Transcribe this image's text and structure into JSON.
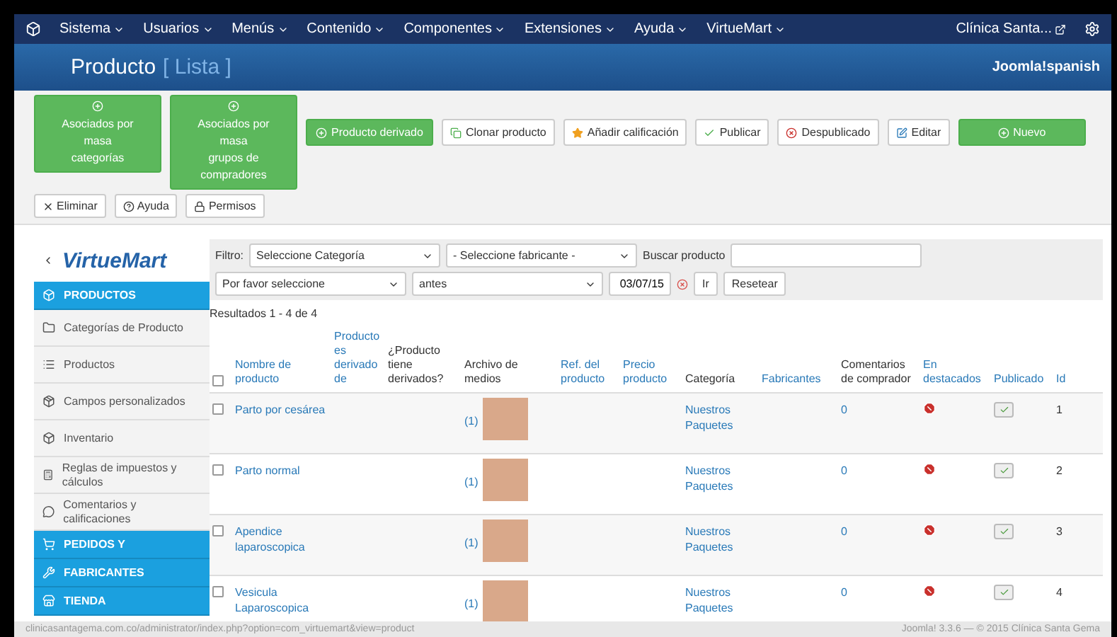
{
  "top_menu": {
    "items": [
      "Sistema",
      "Usuarios",
      "Menús",
      "Contenido",
      "Componentes",
      "Extensiones",
      "Ayuda",
      "VirtueMart"
    ],
    "site": "Clínica Santa..."
  },
  "header": {
    "title": "Producto",
    "subtitle": "[ Lista ]",
    "brand": "Joomla!spanish"
  },
  "toolbar": {
    "buttons": [
      {
        "kind": "green",
        "label": "Asociados por\nmasa\ncategorías"
      },
      {
        "kind": "green",
        "label": "Asociados por\nmasa\ngrupos de\ncompradores"
      },
      {
        "kind": "green",
        "label": "Producto derivado"
      },
      {
        "kind": "plain",
        "label": "Clonar producto"
      },
      {
        "kind": "plain",
        "label": "Añadir calificación"
      },
      {
        "kind": "plain",
        "label": "Publicar"
      },
      {
        "kind": "plain",
        "label": "Despublicado"
      },
      {
        "kind": "plain",
        "label": "Editar"
      },
      {
        "kind": "wide",
        "label": "Nuevo"
      }
    ],
    "second_row": [
      {
        "label": "Eliminar"
      },
      {
        "label": "Ayuda"
      },
      {
        "label": "Permisos"
      }
    ]
  },
  "sidebar": {
    "logo": "VirtueMart",
    "items": [
      {
        "kind": "section",
        "label": "PRODUCTOS"
      },
      {
        "kind": "item",
        "label": "Categorías de Producto"
      },
      {
        "kind": "item",
        "label": "Productos"
      },
      {
        "kind": "item",
        "label": "Campos personalizados"
      },
      {
        "kind": "item",
        "label": "Inventario"
      },
      {
        "kind": "item",
        "label": "Reglas de impuestos y cálculos"
      },
      {
        "kind": "item",
        "label": "Comentarios y calificaciones"
      },
      {
        "kind": "section",
        "label": "PEDIDOS Y"
      },
      {
        "kind": "section",
        "label": "FABRICANTES"
      },
      {
        "kind": "section",
        "label": "TIENDA"
      }
    ]
  },
  "filters": {
    "label": "Filtro:",
    "category": "Seleccione Categoría",
    "manufacturer": "- Seleccione fabricante -",
    "search_label": "Buscar producto",
    "period": "Por favor seleccione",
    "relation": "antes",
    "date": "03/07/15",
    "go": "Ir",
    "reset": "Resetear"
  },
  "results": "Resultados 1 - 4 de 4",
  "table": {
    "select_all_checked": false,
    "columns": [
      {
        "label": "Nombre de producto",
        "link": true
      },
      {
        "label": "Producto es derivado de",
        "link": true
      },
      {
        "label": "¿Producto tiene derivados?",
        "link": false
      },
      {
        "label": "Archivo de medios",
        "link": false
      },
      {
        "label": "Ref. del producto",
        "link": true
      },
      {
        "label": "Precio producto",
        "link": true
      },
      {
        "label": "Categoría",
        "link": false
      },
      {
        "label": "Fabricantes",
        "link": true
      },
      {
        "label": "Comentarios de comprador",
        "link": false
      },
      {
        "label": "En destacados",
        "link": true
      },
      {
        "label": "Publicado",
        "link": true
      },
      {
        "label": "Id",
        "link": true
      }
    ],
    "rows": [
      {
        "checked": false,
        "name": "Parto por cesárea",
        "media": "(1)",
        "category": "Nuestros Paquetes",
        "comments": "0",
        "featured": false,
        "published": true,
        "id": "1"
      },
      {
        "checked": false,
        "name": "Parto normal",
        "media": "(1)",
        "category": "Nuestros Paquetes",
        "comments": "0",
        "featured": false,
        "published": true,
        "id": "2"
      },
      {
        "checked": false,
        "name": "Apendice laparoscopica",
        "media": "(1)",
        "category": "Nuestros Paquetes",
        "comments": "0",
        "featured": false,
        "published": true,
        "id": "3"
      },
      {
        "checked": false,
        "name": "Vesicula Laparoscopica",
        "media": "(1)",
        "category": "Nuestros Paquetes",
        "comments": "0",
        "featured": false,
        "published": true,
        "id": "4"
      }
    ]
  },
  "status_bar": {
    "url": "clinicasantagema.com.co/administrator/index.php?option=com_virtuemart&view=product",
    "footer": "Joomla! 3.3.6 — © 2015 Clínica Santa Gema"
  }
}
